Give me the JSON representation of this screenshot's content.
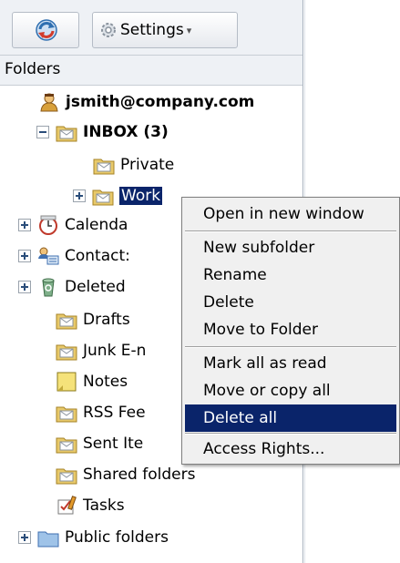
{
  "toolbar": {
    "settings_label": "Settings",
    "caret": "▾"
  },
  "folders_header": "Folders",
  "account": "jsmith@company.com",
  "tree": [
    {
      "label": "INBOX (3)",
      "icon": "mail-folder-icon"
    },
    {
      "label": "Private",
      "icon": "mail-folder-icon"
    },
    {
      "label": "Work",
      "icon": "mail-folder-icon",
      "selected": true
    },
    {
      "label": "Calenda",
      "icon": "calendar-icon"
    },
    {
      "label": "Contact:",
      "icon": "contacts-icon"
    },
    {
      "label": "Deleted",
      "icon": "recycle-bin-icon"
    },
    {
      "label": "Drafts",
      "icon": "mail-folder-icon"
    },
    {
      "label": "Junk E-n",
      "icon": "mail-folder-icon"
    },
    {
      "label": "Notes",
      "icon": "note-icon"
    },
    {
      "label": "RSS Fee",
      "icon": "mail-folder-icon"
    },
    {
      "label": "Sent Ite",
      "icon": "mail-folder-icon"
    },
    {
      "label": "Shared folders",
      "icon": "mail-folder-icon"
    },
    {
      "label": "Tasks",
      "icon": "tasks-icon"
    },
    {
      "label": "Public folders",
      "icon": "folder-icon"
    }
  ],
  "context_menu": [
    {
      "label": "Open in new window"
    },
    {
      "label": "New subfolder"
    },
    {
      "label": "Rename"
    },
    {
      "label": "Delete"
    },
    {
      "label": "Move to Folder"
    },
    {
      "label": "Mark all as read"
    },
    {
      "label": "Move or copy all"
    },
    {
      "label": "Delete all",
      "highlighted": true
    },
    {
      "label": "Access Rights..."
    }
  ],
  "colors": {
    "selection": "#0a246a",
    "folder": "#e8c96a",
    "refresh": "#2f6fb0"
  }
}
